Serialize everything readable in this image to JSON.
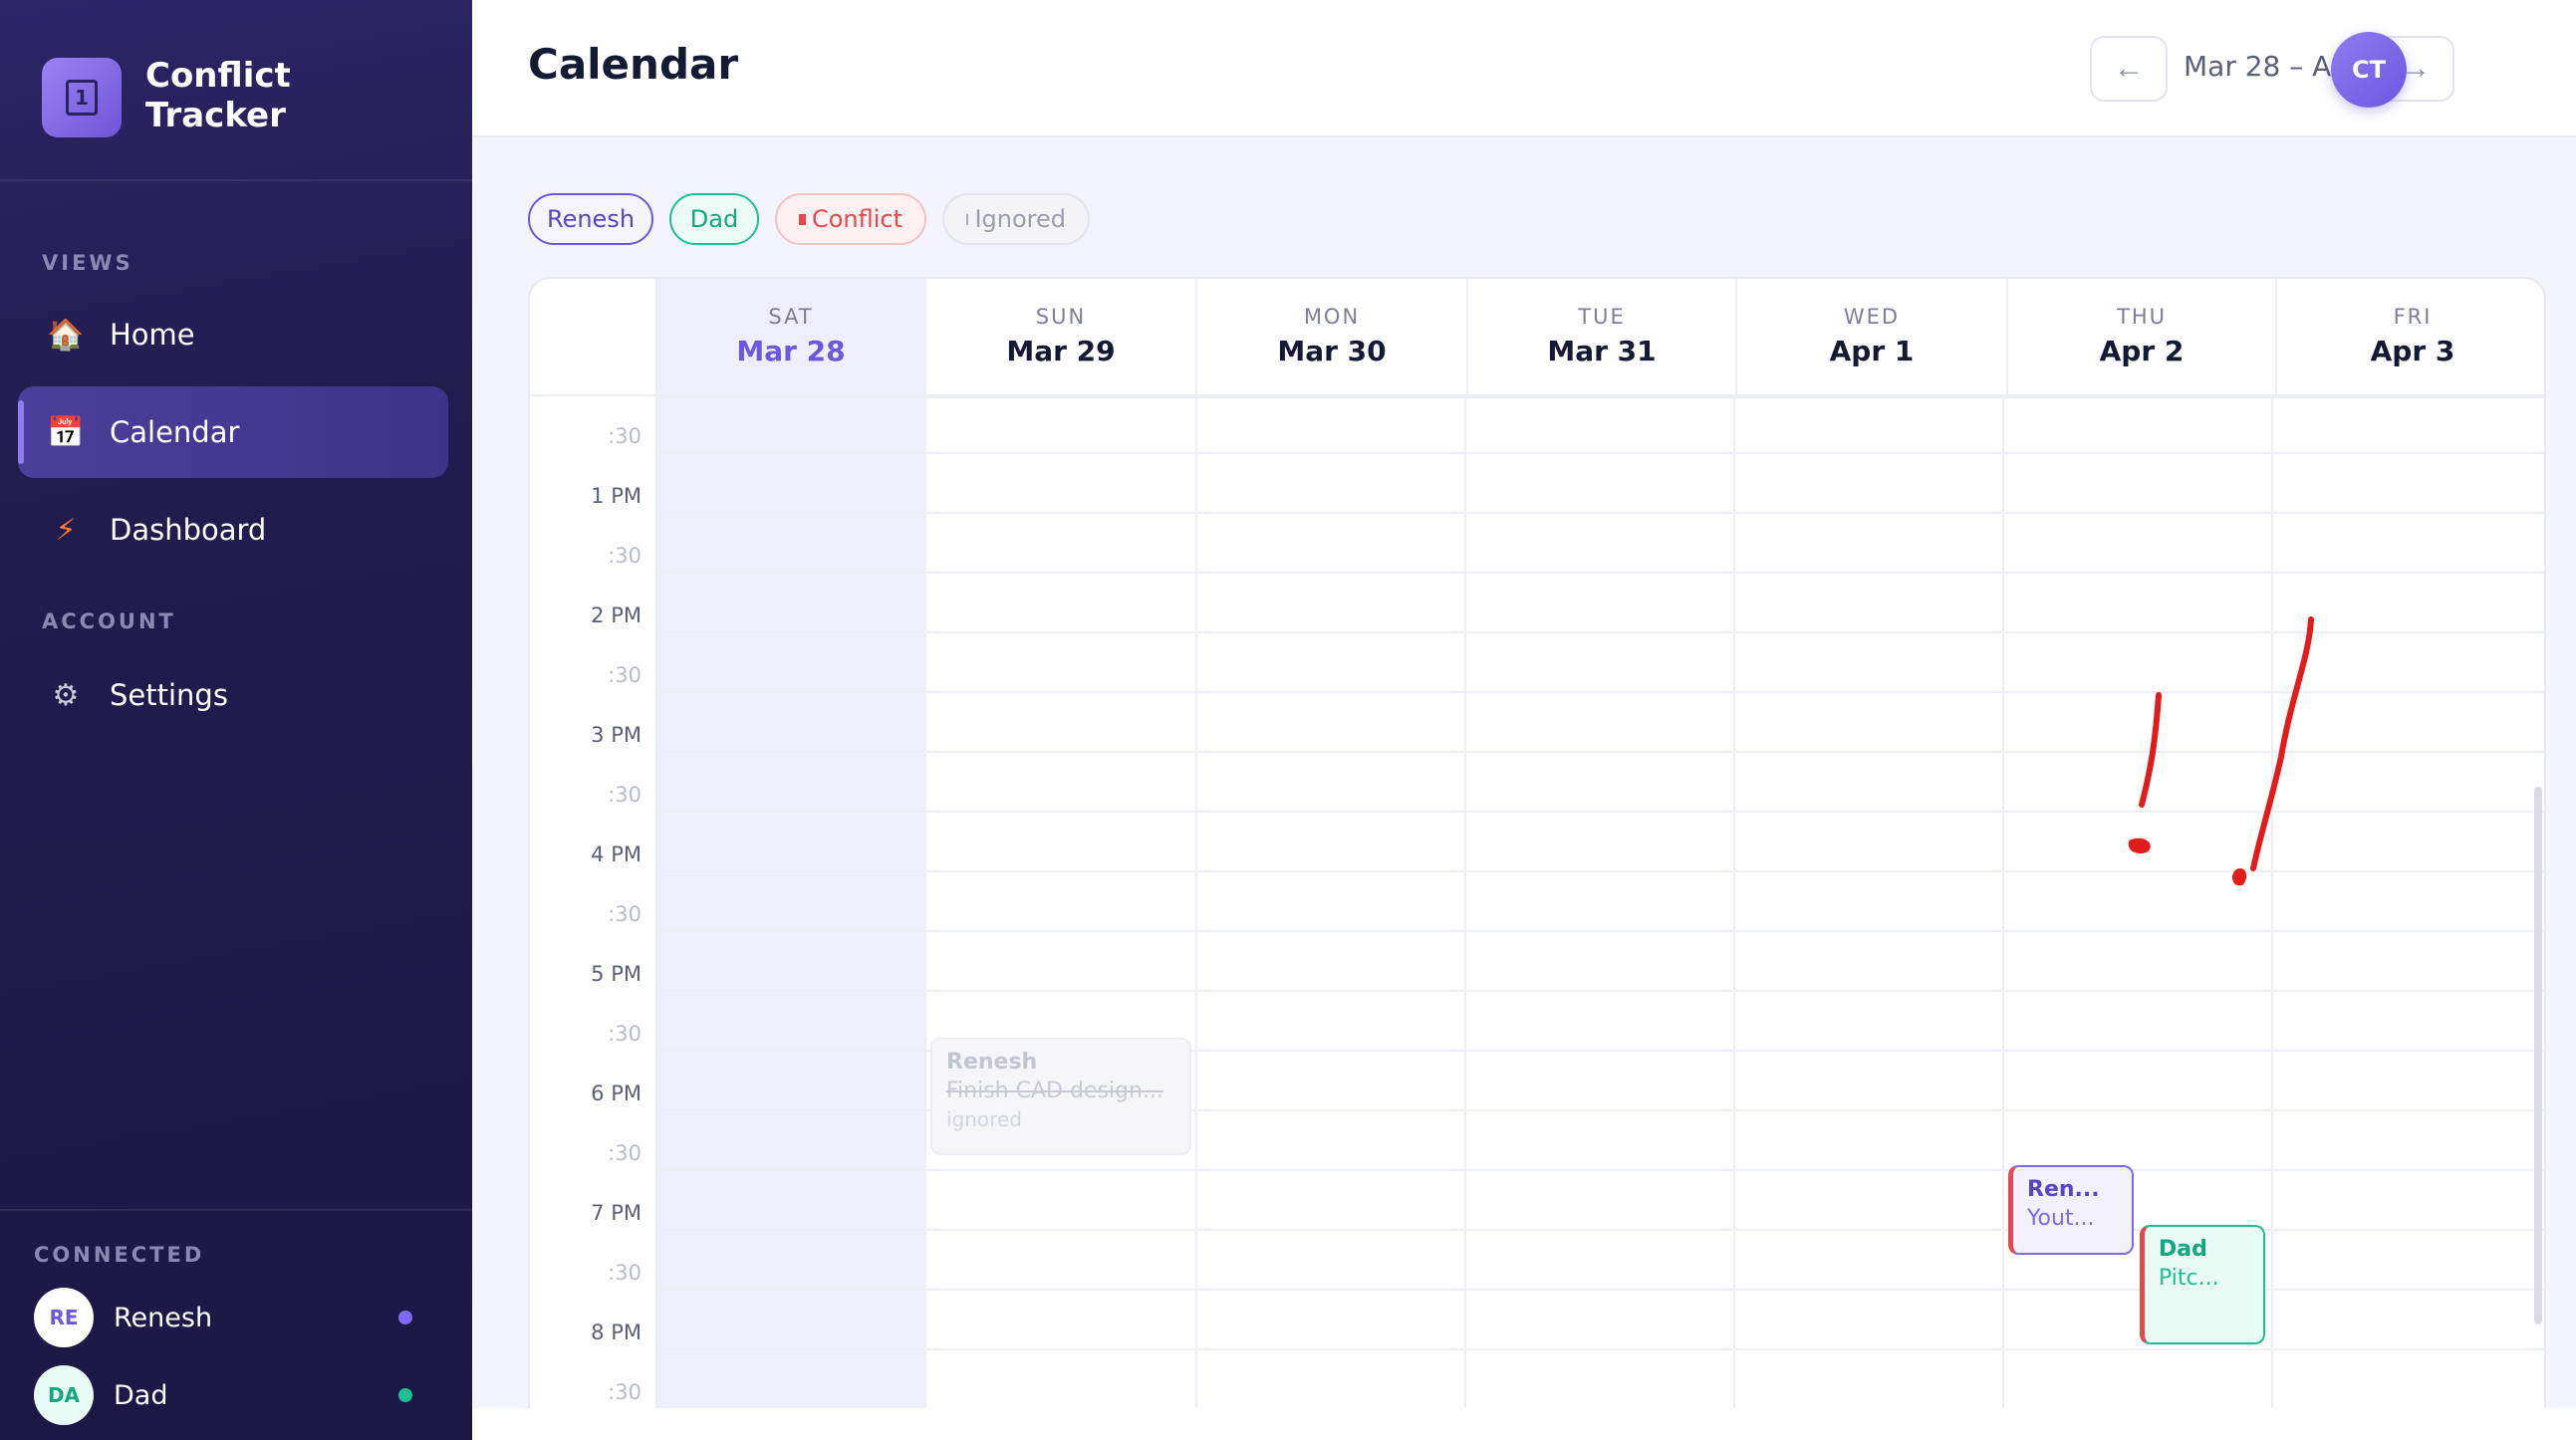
{
  "app": {
    "name": "Conflict Tracker",
    "logo_glyph": "1"
  },
  "sidebar": {
    "views_label": "VIEWS",
    "account_label": "ACCOUNT",
    "connected_label": "CONNECTED",
    "items": [
      {
        "label": "Home",
        "icon": "home-icon",
        "glyph": "🏠"
      },
      {
        "label": "Calendar",
        "icon": "calendar-icon",
        "glyph": "📅",
        "active": true
      },
      {
        "label": "Dashboard",
        "icon": "lightning-icon",
        "glyph": "⚡"
      },
      {
        "label": "Settings",
        "icon": "gear-icon",
        "glyph": "⚙"
      }
    ],
    "connected": [
      {
        "initials": "RE",
        "name": "Renesh",
        "color": "#7c6bf0"
      },
      {
        "initials": "DA",
        "name": "Dad",
        "color": "#1fbf94"
      }
    ]
  },
  "topbar": {
    "title": "Calendar",
    "prev_glyph": "←",
    "next_glyph": "→",
    "range": "Mar 28 – Apr 3",
    "user_initials": "CT"
  },
  "filters": [
    {
      "label": "Renesh"
    },
    {
      "label": "Dad"
    },
    {
      "label": "Conflict"
    },
    {
      "label": "Ignored"
    }
  ],
  "days": [
    {
      "dow": "SAT",
      "date": "Mar 28",
      "today": true
    },
    {
      "dow": "SUN",
      "date": "Mar 29"
    },
    {
      "dow": "MON",
      "date": "Mar 30"
    },
    {
      "dow": "TUE",
      "date": "Mar 31"
    },
    {
      "dow": "WED",
      "date": "Apr 1"
    },
    {
      "dow": "THU",
      "date": "Apr 2"
    },
    {
      "dow": "FRI",
      "date": "Apr 3"
    }
  ],
  "time_labels": [
    ":30",
    "1 PM",
    ":30",
    "2 PM",
    ":30",
    "3 PM",
    ":30",
    "4 PM",
    ":30",
    "5 PM",
    ":30",
    "6 PM",
    ":30",
    "7 PM",
    ":30",
    "8 PM",
    ":30"
  ],
  "events": {
    "ignored": {
      "who": "Renesh",
      "what": "Finish CAD design...",
      "note": "ignored"
    },
    "renesh_conflict": {
      "who": "Ren...",
      "what": "Yout..."
    },
    "dad_conflict": {
      "who": "Dad",
      "what": "Pitc..."
    }
  },
  "colors": {
    "accent": "#6d56e0",
    "renesh": "#6d56e0",
    "dad": "#13a67f",
    "conflict": "#e5484d",
    "annotation": "#e31b1b"
  }
}
